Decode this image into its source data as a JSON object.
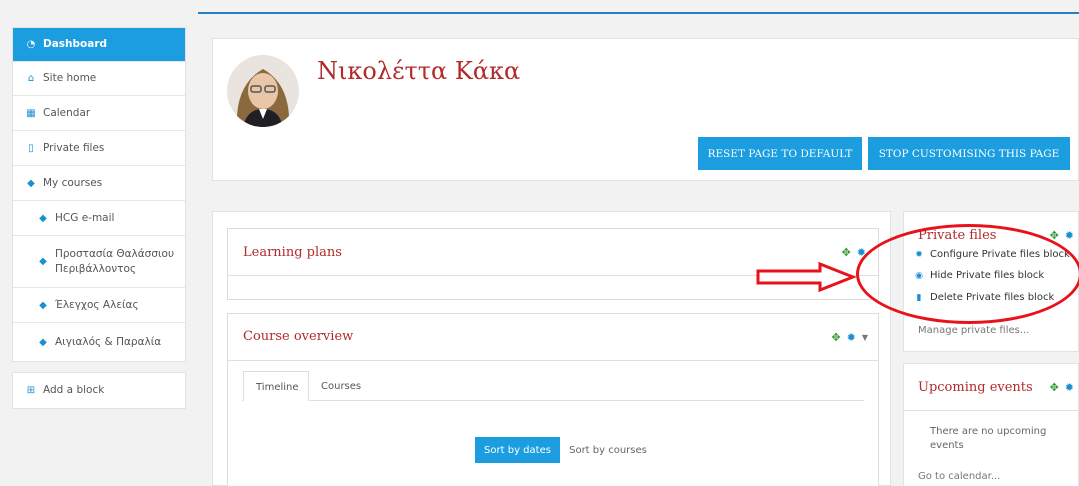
{
  "sidebar": {
    "items": [
      {
        "label": "Dashboard",
        "icon": "dashboard-icon"
      },
      {
        "label": "Site home",
        "icon": "home-icon"
      },
      {
        "label": "Calendar",
        "icon": "calendar-icon"
      },
      {
        "label": "Private files",
        "icon": "file-icon"
      },
      {
        "label": "My courses",
        "icon": "graduation-cap-icon"
      },
      {
        "label": "HCG e-mail",
        "icon": "graduation-cap-icon"
      },
      {
        "label": "Προστασία Θαλάσσιου Περιβάλλοντος",
        "icon": "graduation-cap-icon"
      },
      {
        "label": "Έλεγχος Αλείας",
        "icon": "graduation-cap-icon"
      },
      {
        "label": "Αιγιαλός & Παραλία",
        "icon": "graduation-cap-icon"
      }
    ],
    "add_block": {
      "label": "Add a block",
      "icon": "plus-square-icon"
    }
  },
  "profile": {
    "name": "Νικολέττα Κάκα",
    "reset_button": "RESET PAGE TO DEFAULT",
    "stop_button": "STOP CUSTOMISING THIS PAGE"
  },
  "learning_plans": {
    "title": "Learning plans"
  },
  "course_overview": {
    "title": "Course overview",
    "tabs": [
      "Timeline",
      "Courses"
    ],
    "sort_dates": "Sort by dates",
    "sort_courses": "Sort by courses"
  },
  "private_files": {
    "title": "Private files",
    "menu": [
      {
        "label": "Configure Private files block",
        "icon": "gear-icon"
      },
      {
        "label": "Hide Private files block",
        "icon": "eye-icon"
      },
      {
        "label": "Delete Private files block",
        "icon": "trash-icon"
      }
    ],
    "manage_link": "Manage private files..."
  },
  "upcoming_events": {
    "title": "Upcoming events",
    "empty_text": "There are no upcoming events",
    "calendar_link": "Go to calendar..."
  },
  "colors": {
    "primary": "#1b9de0",
    "title_red": "#b22a2a",
    "annotation_red": "#e8121b"
  }
}
